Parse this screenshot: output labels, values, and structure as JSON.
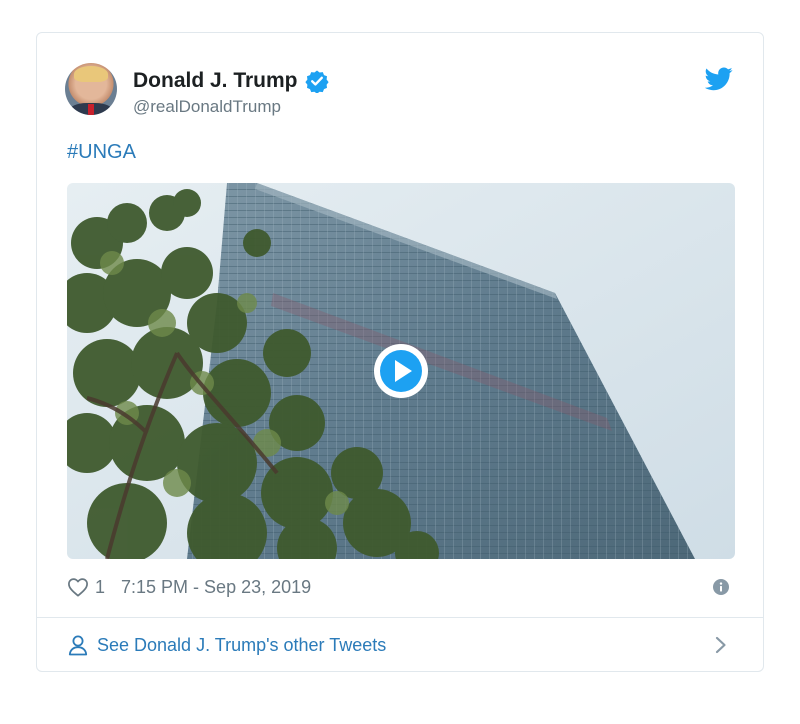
{
  "tweet": {
    "author": {
      "display_name": "Donald J. Trump",
      "handle": "@realDonaldTrump",
      "verified": true
    },
    "text": "#UNGA",
    "media": {
      "type": "video",
      "play_icon": "play-icon"
    },
    "like_count": "1",
    "timestamp": "7:15 PM - Sep 23, 2019"
  },
  "footer": {
    "link_label": "See Donald J. Trump's other Tweets"
  },
  "icons": {
    "brand": "twitter-bird-icon",
    "verified": "verified-badge-icon",
    "like": "heart-icon",
    "info": "info-icon",
    "profile": "person-icon",
    "more": "chevron-right-icon"
  },
  "colors": {
    "accent": "#1da1f2",
    "link": "#2b7bb9",
    "secondary_text": "#697882",
    "border": "#e1e8ed"
  }
}
